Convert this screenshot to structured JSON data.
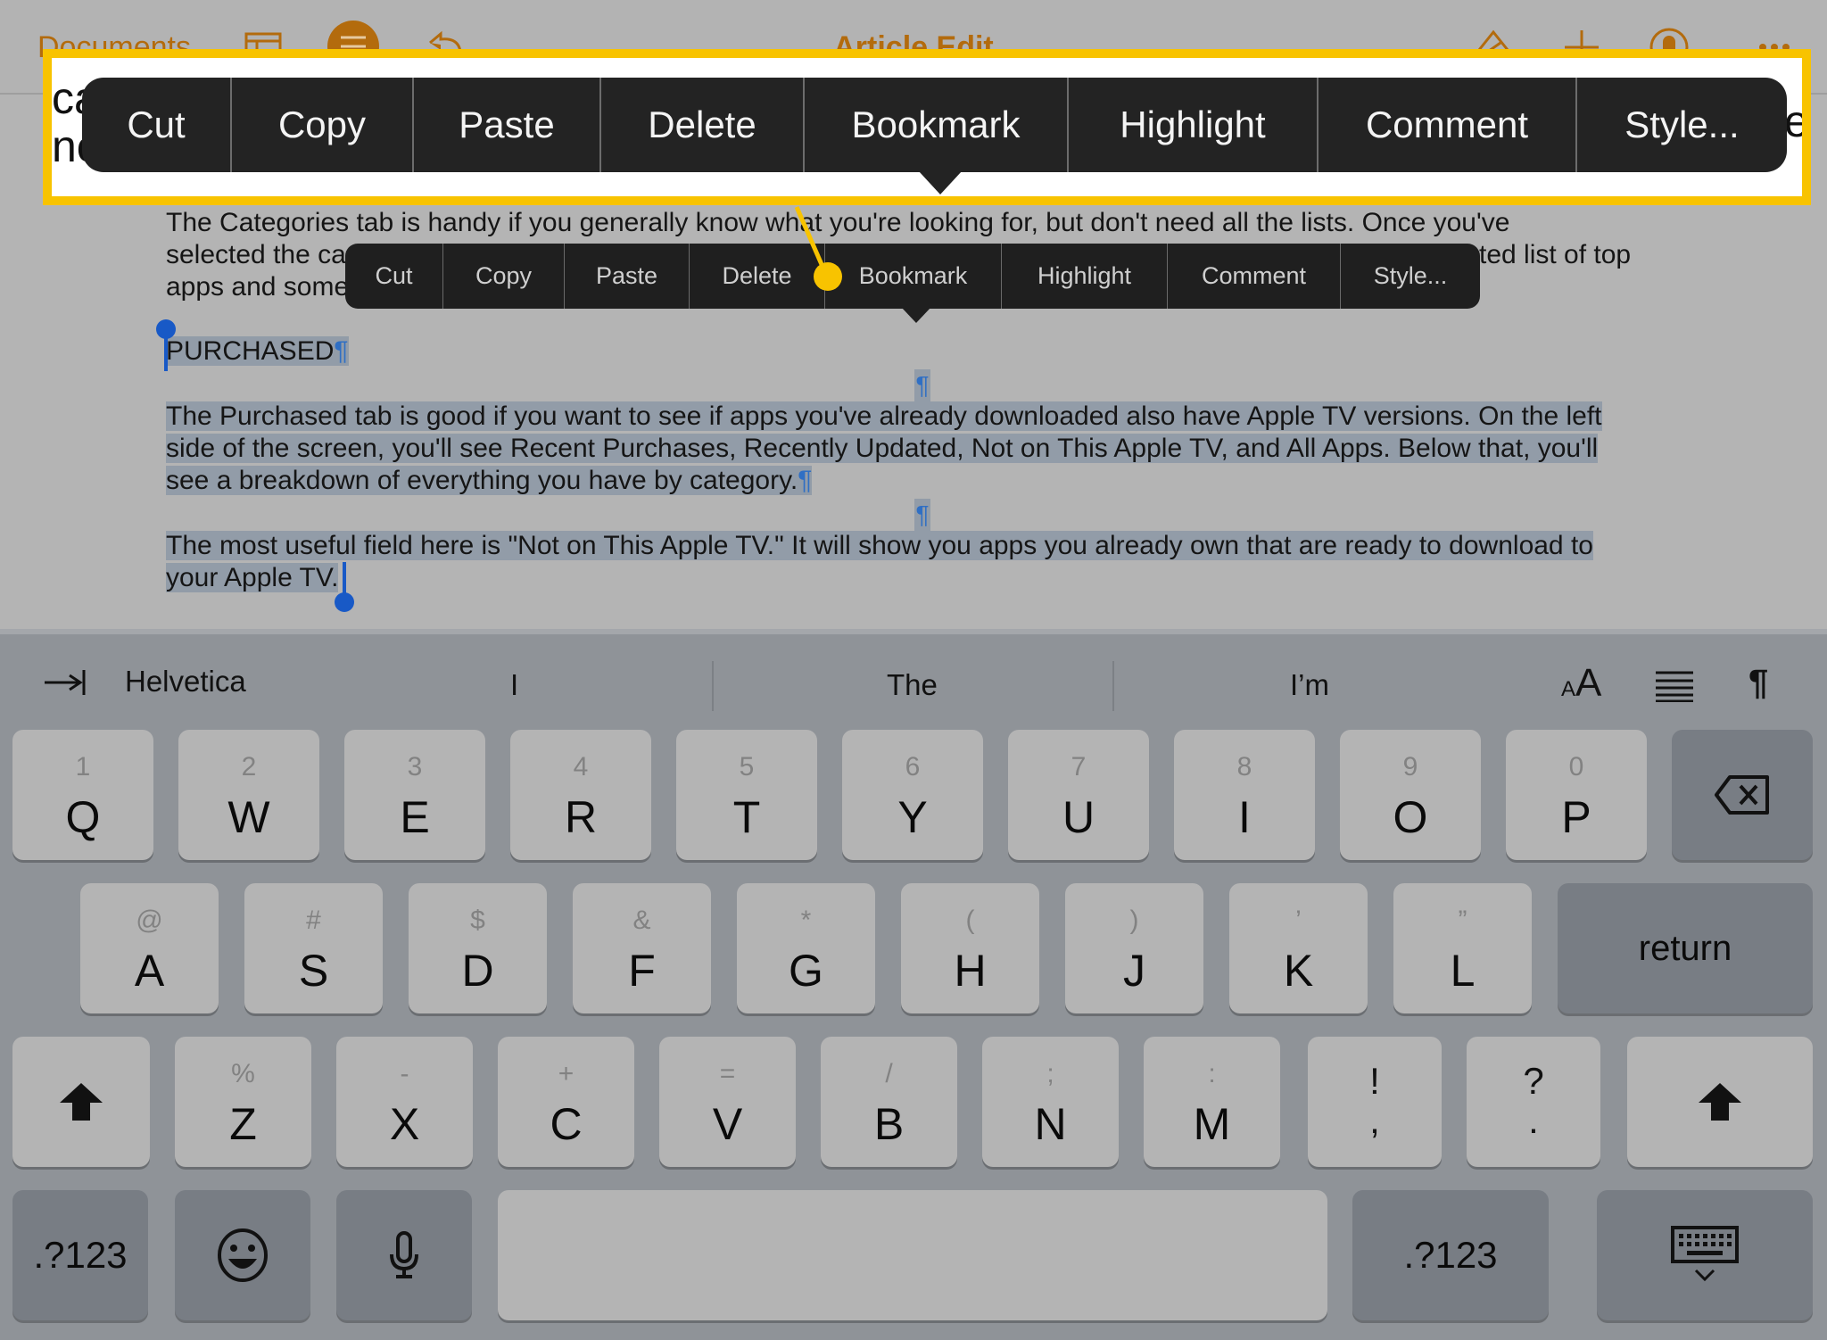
{
  "navbar": {
    "back_label": "Documents",
    "title": "Article Edit",
    "icons_left": [
      "layout-icon",
      "list-format-icon",
      "undo-icon"
    ],
    "icons_right": [
      "paintbrush-icon",
      "add-icon",
      "collaborate-icon",
      "more-icon"
    ]
  },
  "document": {
    "paragraph1": {
      "line1": "The Categories tab is handy if you generally know what you're looking for, but don't need all the lists. Once you've",
      "line2_start": "selected the ca",
      "line2_end": "ted list of top",
      "line3_start": "apps and some"
    },
    "heading": "PURCHASED",
    "paragraph2": {
      "line1": "The Purchased tab is good if you want to see if apps you've already downloaded also have Apple TV versions. On the left",
      "line2": "side of the screen, you'll see Recent Purchases, Recently Updated, Not on This Apple TV, and All Apps. Below that, you'll",
      "line3": "see a breakdown of everything you have by category."
    },
    "paragraph3": {
      "line1": "The most useful field here is \"Not on This Apple TV.\" It will show you apps you already own that are ready to download to",
      "line2": "your Apple TV."
    },
    "pilcrow": "¶"
  },
  "context_menu": {
    "items": [
      "Cut",
      "Copy",
      "Paste",
      "Delete",
      "Bookmark",
      "Highlight",
      "Comment",
      "Style..."
    ]
  },
  "callout": {
    "highlight_color": "#f8c300",
    "bg_text_line1": "ca",
    "bg_text_line2": "ne",
    "bg_text_right": "te"
  },
  "shortcut_bar": {
    "tab_icon": "tab-indent-icon",
    "font_name": "Helvetica",
    "suggestions": [
      "I",
      "The",
      "I’m"
    ],
    "font_size_label_small": "A",
    "font_size_label_large": "A",
    "align_icon": "justify-icon",
    "pilcrow_label": "¶"
  },
  "keyboard": {
    "row1": [
      {
        "sec": "1",
        "pri": "Q"
      },
      {
        "sec": "2",
        "pri": "W"
      },
      {
        "sec": "3",
        "pri": "E"
      },
      {
        "sec": "4",
        "pri": "R"
      },
      {
        "sec": "5",
        "pri": "T"
      },
      {
        "sec": "6",
        "pri": "Y"
      },
      {
        "sec": "7",
        "pri": "U"
      },
      {
        "sec": "8",
        "pri": "I"
      },
      {
        "sec": "9",
        "pri": "O"
      },
      {
        "sec": "0",
        "pri": "P"
      }
    ],
    "row2": [
      {
        "sec": "@",
        "pri": "A"
      },
      {
        "sec": "#",
        "pri": "S"
      },
      {
        "sec": "$",
        "pri": "D"
      },
      {
        "sec": "&",
        "pri": "F"
      },
      {
        "sec": "*",
        "pri": "G"
      },
      {
        "sec": "(",
        "pri": "H"
      },
      {
        "sec": ")",
        "pri": "J"
      },
      {
        "sec": "’",
        "pri": "K"
      },
      {
        "sec": "”",
        "pri": "L"
      }
    ],
    "row3": [
      {
        "sec": "%",
        "pri": "Z"
      },
      {
        "sec": "-",
        "pri": "X"
      },
      {
        "sec": "+",
        "pri": "C"
      },
      {
        "sec": "=",
        "pri": "V"
      },
      {
        "sec": "/",
        "pri": "B"
      },
      {
        "sec": ";",
        "pri": "N"
      },
      {
        "sec": ":",
        "pri": "M"
      }
    ],
    "punct_keys": [
      {
        "top": "!",
        "bottom": ","
      },
      {
        "top": "?",
        "bottom": "."
      }
    ],
    "return_label": "return",
    "numbers_label": ".?123",
    "space_label": ""
  }
}
